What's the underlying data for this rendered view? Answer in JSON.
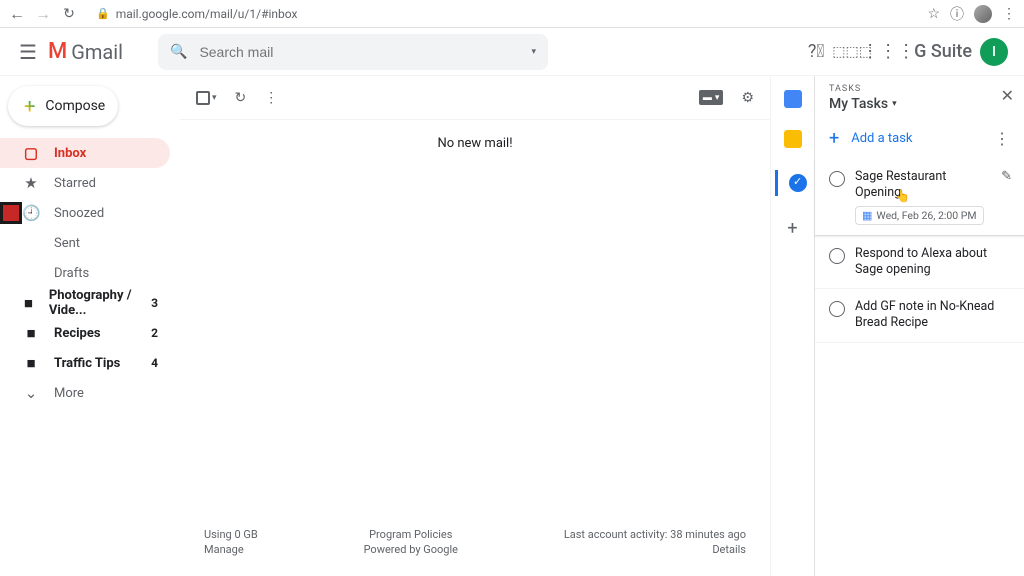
{
  "browser": {
    "url": "mail.google.com/mail/u/1/#inbox"
  },
  "header": {
    "brand": "Gmail",
    "search_placeholder": "Search mail",
    "gsuite": "G Suite",
    "avatar_initial": "I"
  },
  "compose": {
    "label": "Compose"
  },
  "nav": {
    "inbox": "Inbox",
    "starred": "Starred",
    "snoozed": "Snoozed",
    "sent": "Sent",
    "drafts": "Drafts",
    "more": "More",
    "labels": [
      {
        "name": "Photography / Vide...",
        "count": "3"
      },
      {
        "name": "Recipes",
        "count": "2"
      },
      {
        "name": "Traffic Tips",
        "count": "4"
      }
    ]
  },
  "content": {
    "empty": "No new mail!"
  },
  "footer": {
    "storage": "Using 0 GB",
    "manage": "Manage",
    "policies": "Program Policies",
    "powered": "Powered by Google",
    "activity": "Last account activity: 38 minutes ago",
    "details": "Details"
  },
  "tasks": {
    "label": "TASKS",
    "list_name": "My Tasks",
    "add": "Add a task",
    "items": [
      {
        "title": "Sage Restaurant Opening",
        "date": "Wed, Feb 26, 2:00 PM"
      },
      {
        "title": "Respond to Alexa about Sage opening"
      },
      {
        "title": "Add GF note in No-Knead Bread Recipe"
      }
    ]
  }
}
